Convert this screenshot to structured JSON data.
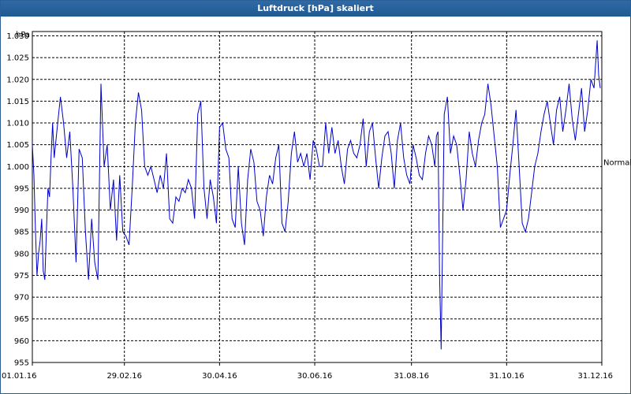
{
  "window": {
    "title": "Luftdruck [hPa] skaliert"
  },
  "chart_data": {
    "type": "line",
    "title": "Luftdruck [hPa] skaliert",
    "ylabel": "hPa",
    "ylim": [
      955,
      1031
    ],
    "yticks": [
      1030,
      1025,
      1020,
      1015,
      1010,
      1005,
      1000,
      995,
      990,
      985,
      980,
      975,
      970,
      965,
      960,
      955
    ],
    "ytick_labels": [
      "1.030",
      "1.025",
      "1.020",
      "1.015",
      "1.010",
      "1.005",
      "1.000",
      "995",
      "990",
      "985",
      "980",
      "975",
      "970",
      "965",
      "960",
      "955"
    ],
    "xlim": [
      1,
      366
    ],
    "xticks": [
      1,
      60,
      121,
      182,
      244,
      305,
      366
    ],
    "xtick_labels": [
      "01.01.16",
      "29.02.16",
      "30.04.16",
      "30.06.16",
      "31.08.16",
      "31.10.16",
      "31.12.16"
    ],
    "grid": true,
    "reference_line": {
      "label": "Normal",
      "value": 1001
    },
    "series_color": "#0000cc",
    "x": [
      1,
      2,
      3,
      4,
      5,
      6,
      7,
      8,
      9,
      10,
      11,
      12,
      13,
      14,
      15,
      17,
      19,
      21,
      23,
      25,
      27,
      29,
      31,
      33,
      35,
      37,
      39,
      41,
      43,
      45,
      47,
      49,
      51,
      53,
      55,
      57,
      59,
      61,
      63,
      65,
      67,
      69,
      71,
      73,
      75,
      77,
      79,
      81,
      83,
      85,
      87,
      89,
      91,
      93,
      95,
      97,
      99,
      101,
      103,
      105,
      107,
      109,
      111,
      113,
      115,
      117,
      119,
      121,
      123,
      125,
      127,
      129,
      131,
      133,
      135,
      137,
      139,
      141,
      143,
      145,
      147,
      149,
      151,
      153,
      155,
      157,
      159,
      161,
      163,
      165,
      167,
      169,
      171,
      173,
      175,
      177,
      179,
      181,
      183,
      185,
      187,
      189,
      191,
      193,
      195,
      197,
      199,
      201,
      203,
      205,
      207,
      209,
      211,
      213,
      215,
      217,
      219,
      221,
      223,
      225,
      227,
      229,
      231,
      233,
      235,
      237,
      239,
      241,
      243,
      245,
      247,
      249,
      251,
      253,
      255,
      257,
      259,
      260,
      261,
      262,
      263,
      265,
      267,
      269,
      271,
      273,
      275,
      277,
      279,
      281,
      283,
      285,
      287,
      289,
      291,
      293,
      295,
      297,
      299,
      301,
      303,
      305,
      307,
      309,
      311,
      313,
      315,
      317,
      319,
      321,
      323,
      325,
      327,
      329,
      331,
      333,
      335,
      337,
      339,
      341,
      343,
      345,
      347,
      349,
      351,
      353,
      355,
      357,
      359,
      361,
      363,
      364,
      365,
      366
    ],
    "values": [
      1005,
      998,
      985,
      975,
      980,
      983,
      988,
      976,
      974,
      985,
      995,
      993,
      1002,
      1010,
      1002,
      1009,
      1016,
      1010,
      1002,
      1008,
      995,
      978,
      1004,
      1002,
      985,
      974,
      988,
      978,
      974,
      1019,
      1000,
      1005,
      990,
      997,
      983,
      998,
      985,
      984,
      982,
      995,
      1010,
      1017,
      1013,
      1000,
      998,
      1000,
      997,
      994,
      998,
      995,
      1003,
      988,
      987,
      993,
      992,
      995,
      994,
      997,
      995,
      988,
      1012,
      1015,
      995,
      988,
      997,
      993,
      987,
      1009,
      1010,
      1004,
      1002,
      988,
      986,
      1000,
      987,
      982,
      997,
      1004,
      1001,
      992,
      990,
      984,
      993,
      998,
      996,
      1002,
      1005,
      987,
      985,
      992,
      1003,
      1008,
      1001,
      1003,
      1000,
      1003,
      997,
      1006,
      1004,
      1000,
      1000,
      1010,
      1003,
      1009,
      1003,
      1006,
      1000,
      996,
      1004,
      1006,
      1003,
      1002,
      1005,
      1011,
      1000,
      1008,
      1010,
      1002,
      995,
      1002,
      1007,
      1008,
      1003,
      995,
      1006,
      1010,
      1002,
      998,
      996,
      1005,
      1002,
      998,
      997,
      1003,
      1007,
      1005,
      1000,
      1007,
      1008,
      975,
      958,
      1012,
      1016,
      1003,
      1007,
      1005,
      998,
      990,
      997,
      1008,
      1003,
      1000,
      1006,
      1010,
      1012,
      1019,
      1014,
      1007,
      1000,
      986,
      988,
      990,
      998,
      1005,
      1013,
      1000,
      987,
      985,
      988,
      994,
      1000,
      1003,
      1008,
      1012,
      1015,
      1010,
      1005,
      1013,
      1016,
      1008,
      1013,
      1019,
      1011,
      1006,
      1012,
      1018,
      1008,
      1013,
      1020,
      1018,
      1029,
      1021,
      1018
    ]
  }
}
